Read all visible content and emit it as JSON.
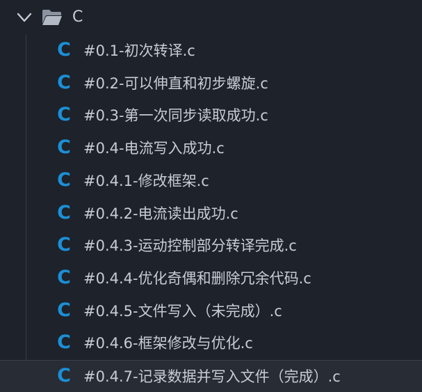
{
  "folder": {
    "name": "C",
    "expanded": true,
    "chevron_icon": "chevron-down-icon",
    "folder_icon": "folder-open-icon"
  },
  "files": [
    {
      "name": "#0.1-初次转译.c",
      "icon": "c-file-icon",
      "icon_glyph": "C"
    },
    {
      "name": "#0.2-可以伸直和初步螺旋.c",
      "icon": "c-file-icon",
      "icon_glyph": "C"
    },
    {
      "name": "#0.3-第一次同步读取成功.c",
      "icon": "c-file-icon",
      "icon_glyph": "C"
    },
    {
      "name": "#0.4-电流写入成功.c",
      "icon": "c-file-icon",
      "icon_glyph": "C"
    },
    {
      "name": "#0.4.1-修改框架.c",
      "icon": "c-file-icon",
      "icon_glyph": "C"
    },
    {
      "name": "#0.4.2-电流读出成功.c",
      "icon": "c-file-icon",
      "icon_glyph": "C"
    },
    {
      "name": "#0.4.3-运动控制部分转译完成.c",
      "icon": "c-file-icon",
      "icon_glyph": "C"
    },
    {
      "name": "#0.4.4-优化奇偶和删除冗余代码.c",
      "icon": "c-file-icon",
      "icon_glyph": "C"
    },
    {
      "name": "#0.4.5-文件写入（未完成）.c",
      "icon": "c-file-icon",
      "icon_glyph": "C"
    },
    {
      "name": "#0.4.6-框架修改与优化.c",
      "icon": "c-file-icon",
      "icon_glyph": "C"
    },
    {
      "name": "#0.4.7-记录数据并写入文件（完成）.c",
      "icon": "c-file-icon",
      "icon_glyph": "C",
      "selected": true
    }
  ],
  "colors": {
    "background": "#1e222a",
    "text": "#c8ccd4",
    "c_icon": "#1b8fd6",
    "selected_row": "#282c35"
  }
}
